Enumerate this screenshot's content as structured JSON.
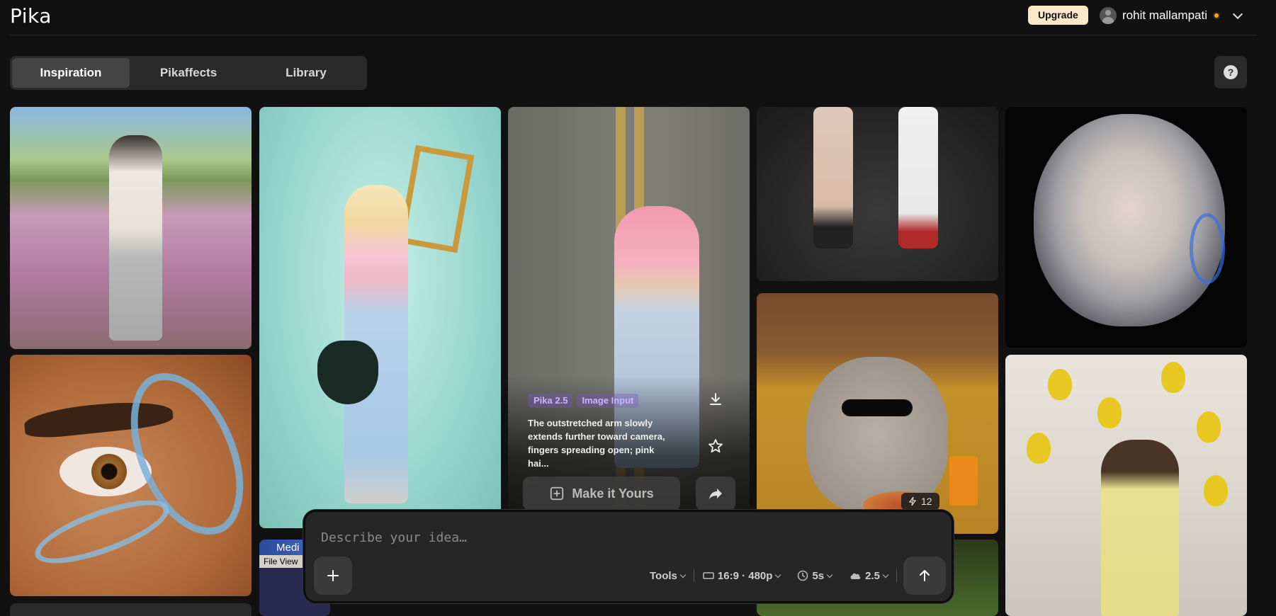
{
  "header": {
    "logo": "Pika",
    "upgrade_label": "Upgrade",
    "username": "rohit mallampati",
    "avatar_icon": "user-avatar-icon",
    "status_color": "#f5a623"
  },
  "tabs": [
    {
      "label": "Inspiration",
      "active": true
    },
    {
      "label": "Pikaffects",
      "active": false
    },
    {
      "label": "Library",
      "active": false
    }
  ],
  "help": {
    "icon": "help-icon",
    "symbol": "?"
  },
  "featured": {
    "tags": [
      "Pika 2.5",
      "Image Input"
    ],
    "description": "The outstretched arm slowly extends further toward camera, fingers spreading open; pink hai...",
    "make_label": "Make it Yours",
    "download_icon": "download-icon",
    "star_icon": "star-icon",
    "share_icon": "share-icon"
  },
  "credit_badge": {
    "icon": "lightning-icon",
    "count": "12"
  },
  "window_thumb": {
    "title": "Medi",
    "menu": "File  View"
  },
  "prompt": {
    "placeholder": "Describe your idea…",
    "tools_label": "Tools",
    "aspect_label": "16:9 · 480p",
    "duration_label": "5s",
    "model_label": "2.5",
    "add_icon": "plus-icon",
    "send_icon": "arrow-up-icon"
  },
  "colors": {
    "background": "#111111",
    "panel": "#262626",
    "upgrade_bg": "#fbe8c8",
    "tag_text": "#c8b4ff"
  }
}
